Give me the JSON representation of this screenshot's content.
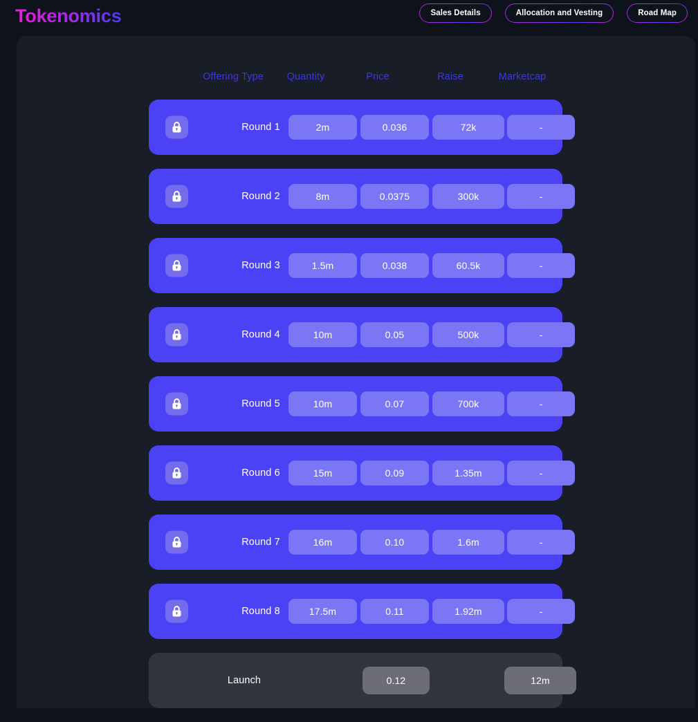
{
  "header": {
    "brand": "Tokenomics",
    "nav": [
      {
        "label": "Sales Details",
        "name": "nav-sales-details"
      },
      {
        "label": "Allocation and Vesting",
        "name": "nav-allocation-and-vesting"
      },
      {
        "label": "Road Map",
        "name": "nav-road-map"
      }
    ]
  },
  "table": {
    "columns": [
      "Offering Type",
      "Quantity",
      "Price",
      "Raise",
      "Marketcap"
    ],
    "rows": [
      {
        "icon": "lock-icon",
        "offering_type": "Round 1",
        "quantity": "2m",
        "price": "0.036",
        "raise": "72k",
        "marketcap": "-",
        "locked": true
      },
      {
        "icon": "lock-icon",
        "offering_type": "Round 2",
        "quantity": "8m",
        "price": "0.0375",
        "raise": "300k",
        "marketcap": "-",
        "locked": true
      },
      {
        "icon": "lock-icon",
        "offering_type": "Round 3",
        "quantity": "1.5m",
        "price": "0.038",
        "raise": "60.5k",
        "marketcap": "-",
        "locked": true
      },
      {
        "icon": "lock-icon",
        "offering_type": "Round 4",
        "quantity": "10m",
        "price": "0.05",
        "raise": "500k",
        "marketcap": "-",
        "locked": true
      },
      {
        "icon": "lock-icon",
        "offering_type": "Round 5",
        "quantity": "10m",
        "price": "0.07",
        "raise": "700k",
        "marketcap": "-",
        "locked": true
      },
      {
        "icon": "lock-icon",
        "offering_type": "Round 6",
        "quantity": "15m",
        "price": "0.09",
        "raise": "1.35m",
        "marketcap": "-",
        "locked": true
      },
      {
        "icon": "lock-icon",
        "offering_type": "Round 7",
        "quantity": "16m",
        "price": "0.10",
        "raise": "1.6m",
        "marketcap": "-",
        "locked": true
      },
      {
        "icon": "lock-icon",
        "offering_type": "Round 8",
        "quantity": "17.5m",
        "price": "0.11",
        "raise": "1.92m",
        "marketcap": "-",
        "locked": true
      }
    ],
    "launch_row": {
      "offering_type": "Launch",
      "price": "0.12",
      "marketcap": "12m",
      "locked": false
    }
  },
  "colors": {
    "page_background": "#0e121b",
    "panel_background": "#191d28",
    "row_accent": "#4b42f6",
    "cell_accent": "#7b76f5",
    "launch_row": "#32343f",
    "launch_cell": "#6c6d79",
    "column_header_text": "#3b38d8",
    "brand_gradient_start": "#ea1ddd",
    "brand_gradient_end": "#4b3bf7"
  }
}
